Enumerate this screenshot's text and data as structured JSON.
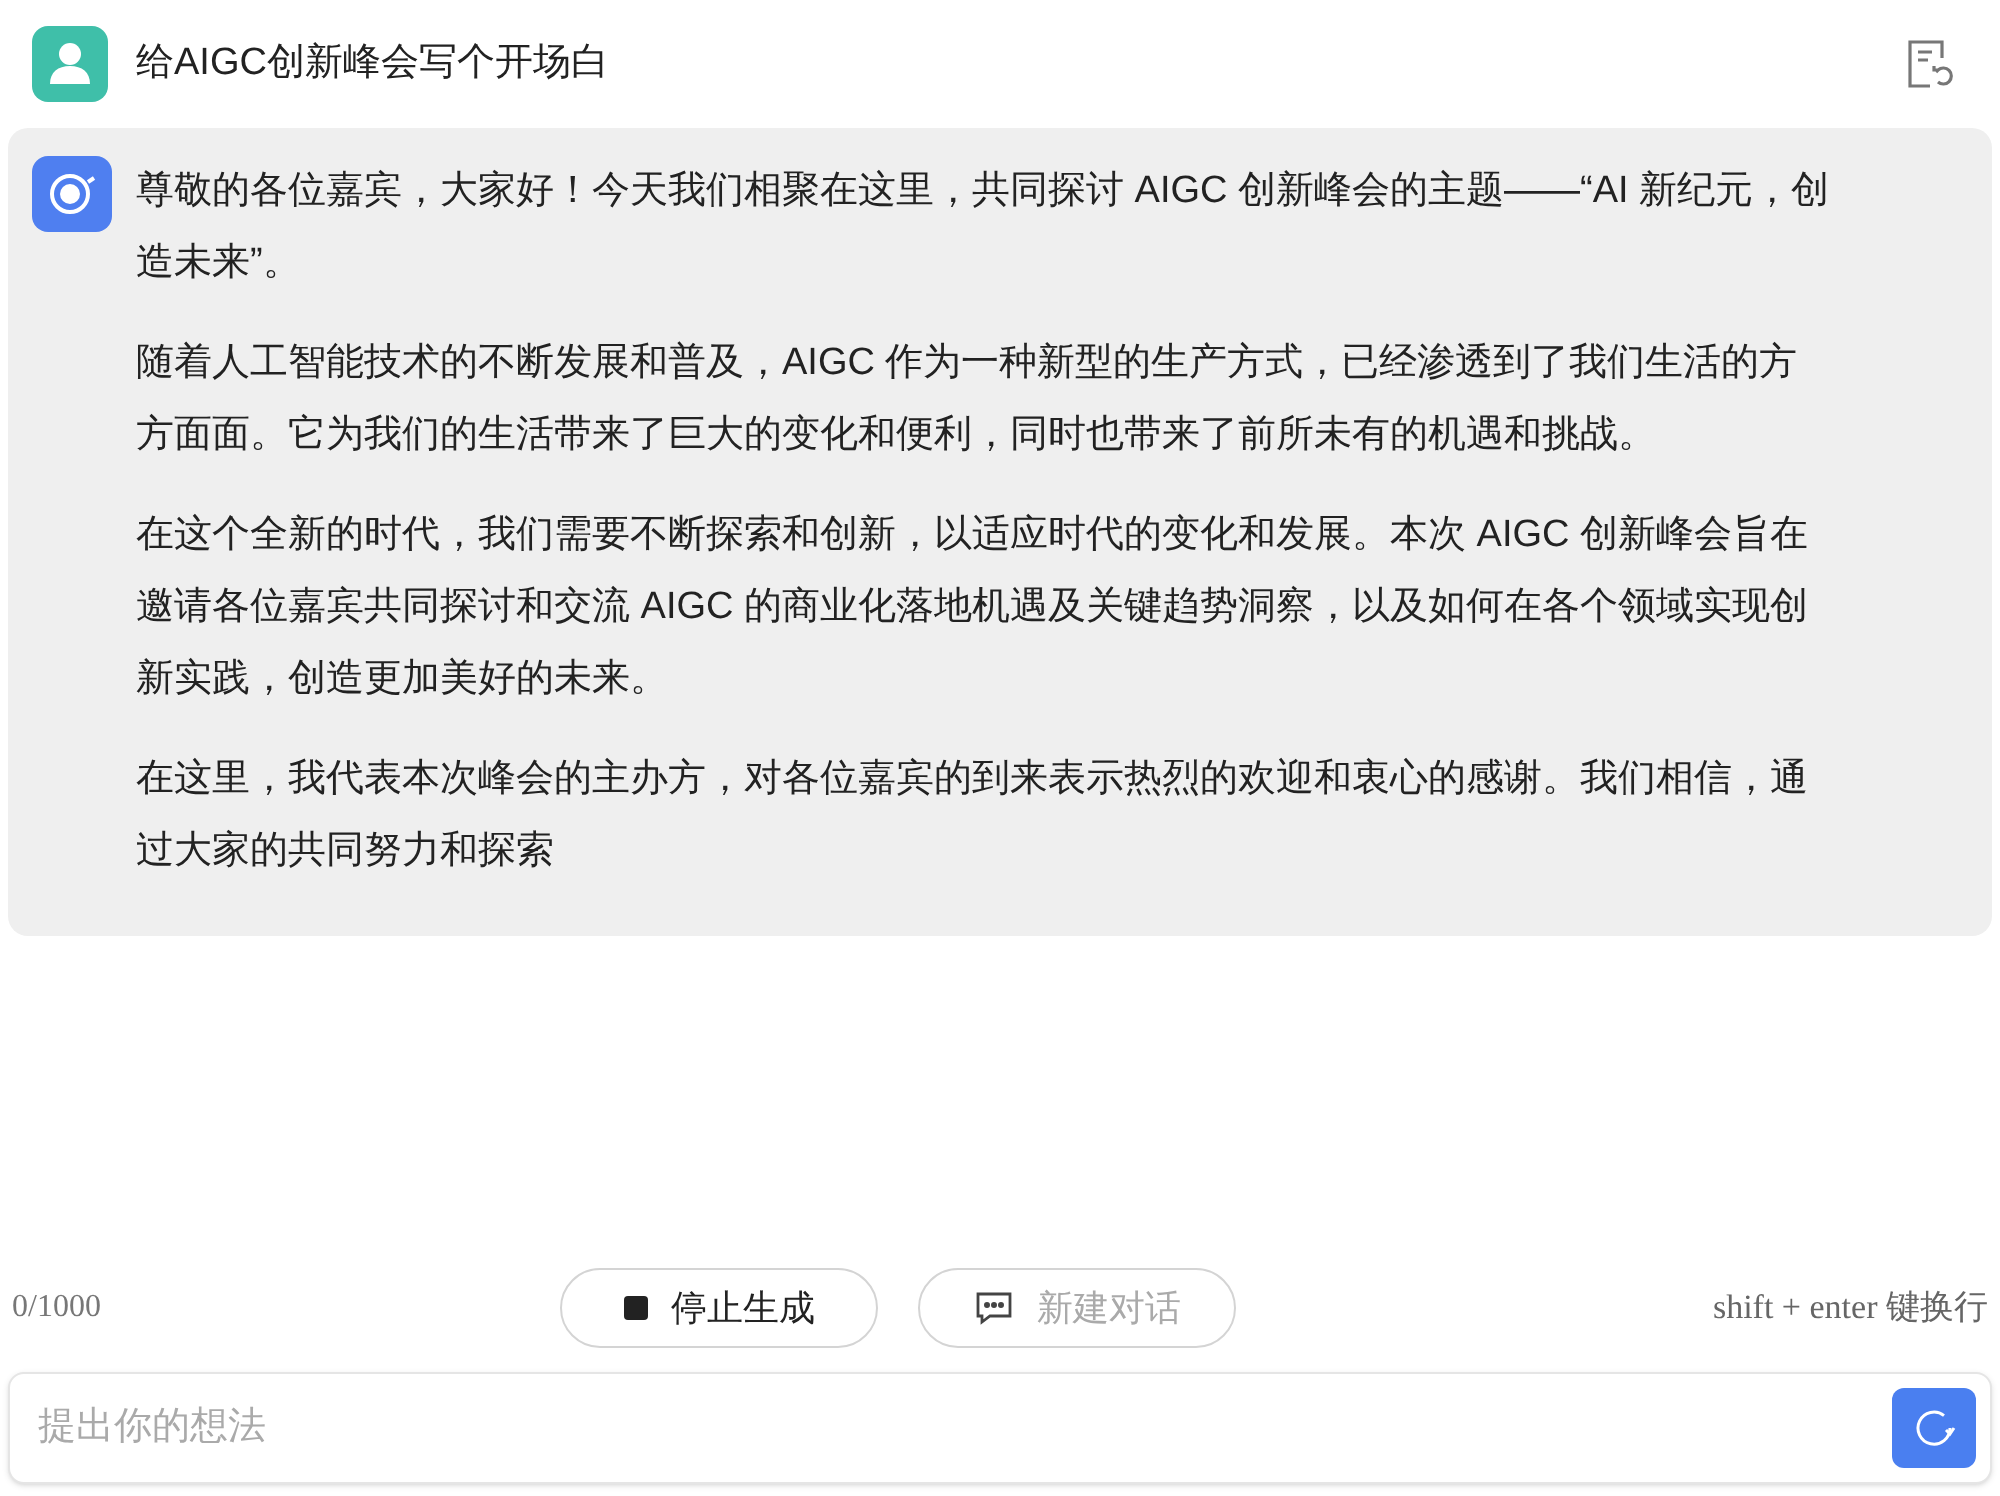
{
  "user_message": {
    "text": "给AIGC创新峰会写个开场白"
  },
  "assistant_message": {
    "paragraphs": [
      "尊敬的各位嘉宾，大家好！今天我们相聚在这里，共同探讨 AIGC 创新峰会的主题——“AI 新纪元，创造未来”。",
      "随着人工智能技术的不断发展和普及，AIGC 作为一种新型的生产方式，已经渗透到了我们生活的方方面面。它为我们的生活带来了巨大的变化和便利，同时也带来了前所未有的机遇和挑战。",
      "在这个全新的时代，我们需要不断探索和创新，以适应时代的变化和发展。本次 AIGC 创新峰会旨在邀请各位嘉宾共同探讨和交流 AIGC 的商业化落地机遇及关键趋势洞察，以及如何在各个领域实现创新实践，创造更加美好的未来。",
      "在这里，我代表本次峰会的主办方，对各位嘉宾的到来表示热烈的欢迎和衷心的感谢。我们相信，通过大家的共同努力和探索"
    ]
  },
  "counter": "0/1000",
  "actions": [
    {
      "kind": "stop",
      "label": "停止生成",
      "disabled": false
    },
    {
      "kind": "new_chat",
      "label": "新建对话",
      "disabled": true
    }
  ],
  "hint": "shift + enter 键换行",
  "input": {
    "placeholder": "提出你的想法"
  }
}
